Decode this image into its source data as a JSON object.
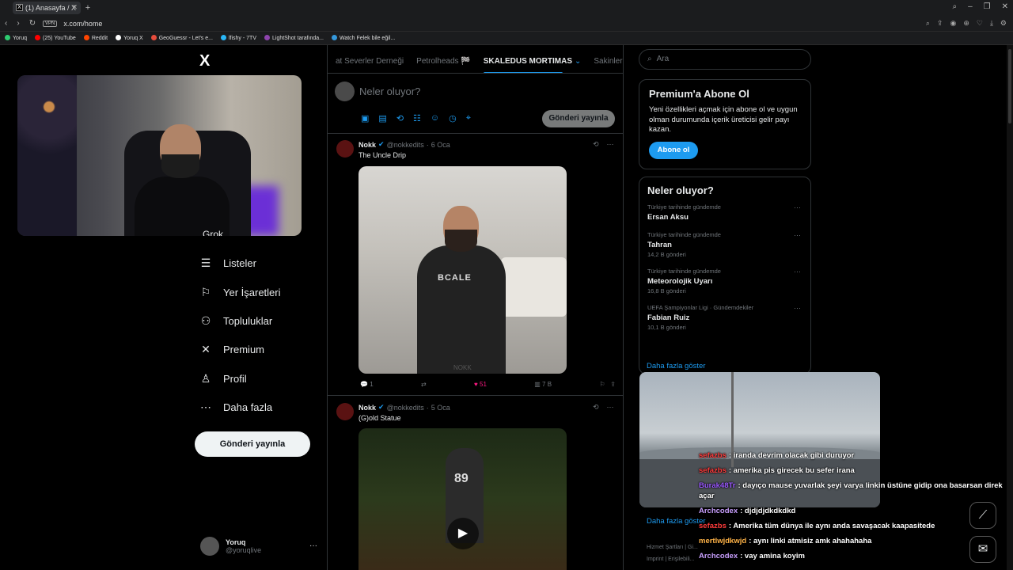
{
  "browser": {
    "tab_title": "(1) Anasayfa / X",
    "tab_favicon": "X",
    "url": "x.com/home",
    "vpn_label": "VPN",
    "bookmarks": [
      {
        "label": "Yoruq",
        "color": "#2ecc71"
      },
      {
        "label": "(25) YouTube",
        "color": "#ff0000"
      },
      {
        "label": "Reddit",
        "color": "#ff4500"
      },
      {
        "label": "Yoruq X",
        "color": "#ffffff"
      },
      {
        "label": "GeoGuessr - Let's e...",
        "color": "#e74c3c"
      },
      {
        "label": "lfishy - 7TV",
        "color": "#29b6f6"
      },
      {
        "label": "LightShot tarafında...",
        "color": "#8e44ad"
      },
      {
        "label": "Watch Felek bile eğil...",
        "color": "#3498db"
      }
    ]
  },
  "sidebar": {
    "logo": "X",
    "grok_label": "Grok",
    "items": [
      {
        "label": "Listeler",
        "icon": "list-icon",
        "glyph": "☰"
      },
      {
        "label": "Yer İşaretleri",
        "icon": "bookmark-icon",
        "glyph": "⚐"
      },
      {
        "label": "Topluluklar",
        "icon": "communities-icon",
        "glyph": "⚇"
      },
      {
        "label": "Premium",
        "icon": "x-premium-icon",
        "glyph": "✕"
      },
      {
        "label": "Profil",
        "icon": "profile-icon",
        "glyph": "♙"
      },
      {
        "label": "Daha fazla",
        "icon": "more-icon",
        "glyph": "⋯"
      }
    ],
    "post_button": "Gönderi yayınla",
    "account": {
      "name": "Yoruq",
      "handle": "@yoruqlive",
      "more": "···"
    }
  },
  "tabs": [
    "at Severler Derneği",
    "Petrolheads 🏁",
    "SKALEDUS MORTIMAS",
    "Sakinler"
  ],
  "active_tab_index": 2,
  "compose": {
    "placeholder": "Neler oluyor?",
    "post_button": "Gönderi yayınla",
    "icons": [
      "image-icon",
      "gif-icon",
      "grok-icon",
      "poll-icon",
      "emoji-icon",
      "schedule-icon",
      "location-icon"
    ]
  },
  "posts": [
    {
      "author": "Nokk",
      "handle": "@nokkedits",
      "date": "6 Oca",
      "text": "The Uncle Drip",
      "shirt_text": "BCALE",
      "watermark": "NOKK",
      "replies": "1",
      "reposts": "",
      "likes": "51",
      "views": "7 B"
    },
    {
      "author": "Nokk",
      "handle": "@nokkedits",
      "date": "5 Oca",
      "text": "(G)old Statue",
      "jersey": "89"
    }
  ],
  "search": {
    "placeholder": "Ara"
  },
  "premium": {
    "title": "Premium'a Abone Ol",
    "description": "Yeni özellikleri açmak için abone ol ve uygun olman durumunda içerik üreticisi gelir payı kazan.",
    "button": "Abone ol"
  },
  "trends": {
    "title": "Neler oluyor?",
    "items": [
      {
        "context": "Türkiye tarihinde gündemde",
        "name": "Ersan Aksu",
        "posts": ""
      },
      {
        "context": "Türkiye tarihinde gündemde",
        "name": "Tahran",
        "posts": "14,2 B gönderi"
      },
      {
        "context": "Türkiye tarihinde gündemde",
        "name": "Meteorolojik Uyarı",
        "posts": "16,8 B gönderi"
      },
      {
        "context": "UEFA Şampiyonlar Ligi · Gündemdekiler",
        "name": "Fabian Ruiz",
        "posts": "10,1 B gönderi"
      }
    ],
    "show_more": "Daha fazla göster"
  },
  "who_to_follow_show_more": "Daha fazla göster",
  "footer": {
    "line1": "Hizmet Şartları  |  Gi...",
    "line2": "Imprint  |  Erişilebili..."
  },
  "chat": [
    {
      "user": "sefazbs",
      "color": "#ff3b3b",
      "text": "iranda devrim olacak gibi duruyor"
    },
    {
      "user": "sefazbs",
      "color": "#ff3b3b",
      "text": "amerika pis girecek bu sefer irana"
    },
    {
      "user": "Burak48Tr",
      "color": "#9b59ff",
      "text": "dayıço mause yuvarlak şeyi varya linkin üstüne gidip ona basarsan direk açar"
    },
    {
      "user": "Archcodex",
      "color": "#c9a0ff",
      "text": "djdjdjdkdkdkd"
    },
    {
      "user": "sefazbs",
      "color": "#ff3b3b",
      "text": "Amerika tüm dünya ile aynı anda savaşacak kaapasitede"
    },
    {
      "user": "mertlwjdkwjd",
      "color": "#ffb347",
      "text": "aynı linki atmisiz amk ahahahaha"
    },
    {
      "user": "Archcodex",
      "color": "#c9a0ff",
      "text": "vay amina koyim"
    }
  ]
}
